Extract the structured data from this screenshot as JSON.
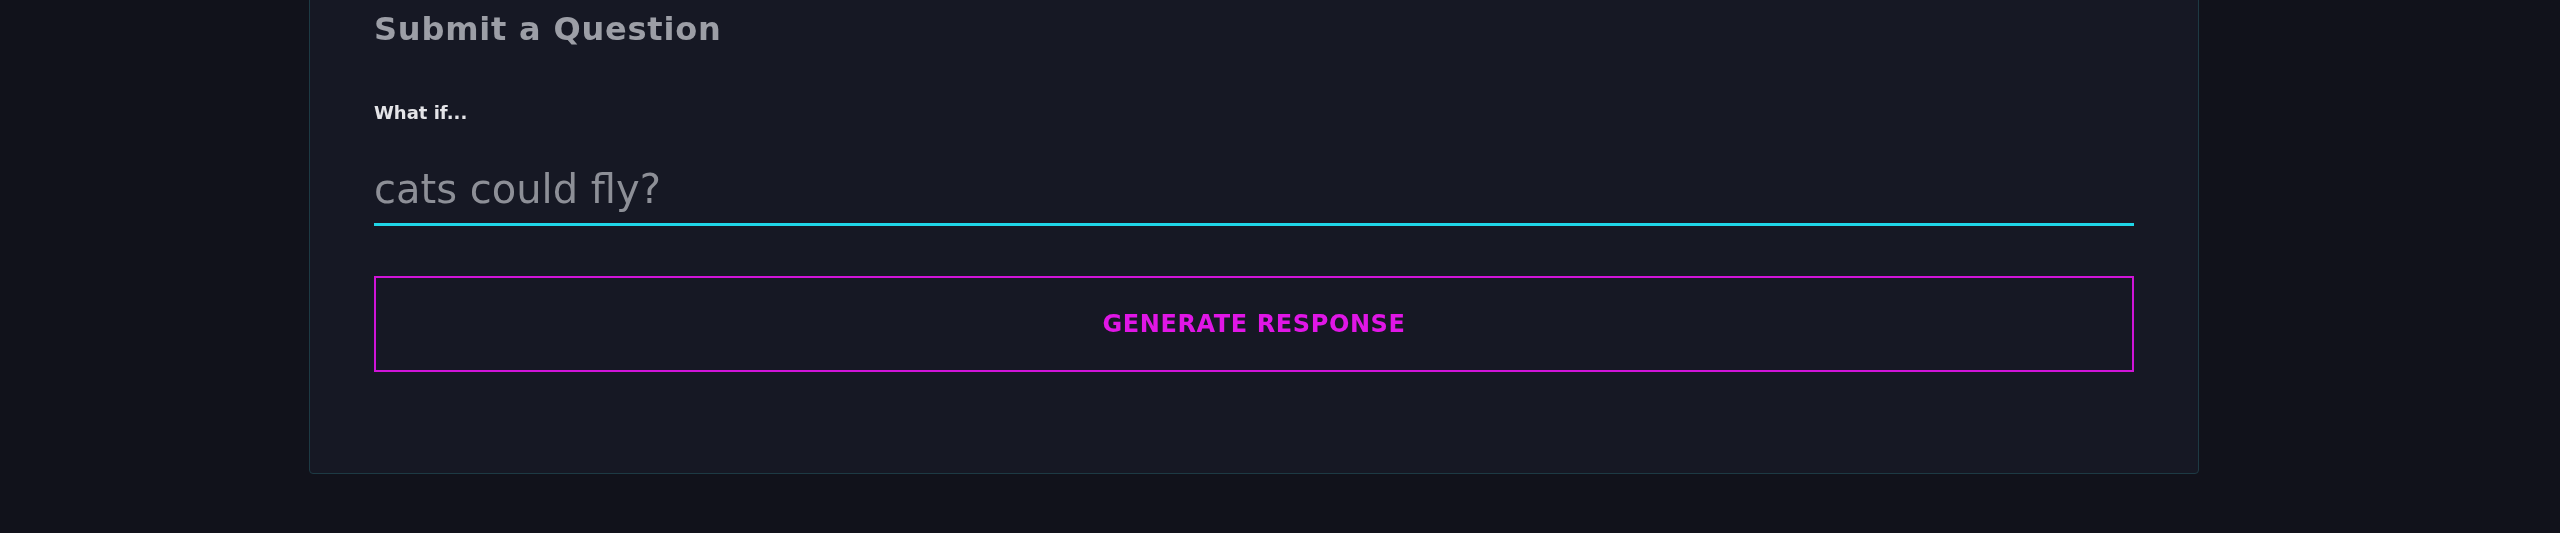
{
  "form": {
    "title": "Submit a Question",
    "field": {
      "label": "What if...",
      "placeholder": "cats could fly?"
    },
    "button": "GENERATE RESPONSE"
  }
}
